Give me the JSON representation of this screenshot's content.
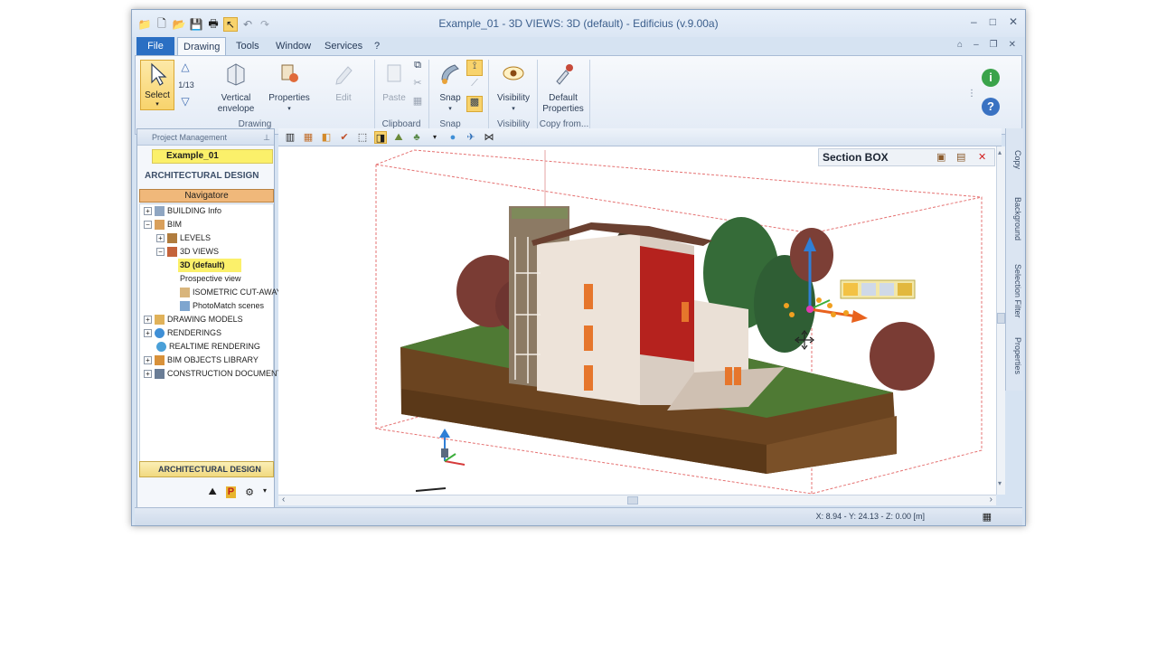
{
  "window": {
    "title": "Example_01  -  3D VIEWS: 3D (default) - Edificius (v.9.00a)",
    "controls": [
      "–",
      "□",
      "✕"
    ],
    "mdi_controls": [
      "⌂",
      "–",
      "❐",
      "✕"
    ]
  },
  "quick_access": [
    "📁",
    "🗋",
    "📂",
    "💾",
    "🖶",
    "↖",
    "↶",
    "↷"
  ],
  "tabs": {
    "file": "File",
    "items": [
      "Drawing",
      "Tools",
      "Window",
      "Services",
      "?"
    ],
    "active": "Drawing"
  },
  "ribbon": {
    "select": "Select",
    "counter": "1/13",
    "vertical_envelope": [
      "Vertical",
      "envelope"
    ],
    "properties": "Properties",
    "edit": "Edit",
    "paste": "Paste",
    "snap": "Snap",
    "visibility": "Visibility",
    "default_properties": [
      "Default",
      "Properties"
    ],
    "groups": [
      "Drawing",
      "Clipboard",
      "Snap",
      "Visibility",
      "Copy from..."
    ]
  },
  "left_panel": {
    "header": "Project Management",
    "project": "Example_01",
    "section_title": "ARCHITECTURAL DESIGN",
    "navigator": "Navigatore",
    "tree": [
      {
        "label": "BUILDING Info",
        "level": 0,
        "expander": "+"
      },
      {
        "label": "BIM",
        "level": 0,
        "expander": "−"
      },
      {
        "label": "LEVELS",
        "level": 1,
        "expander": "+"
      },
      {
        "label": "3D VIEWS",
        "level": 1,
        "expander": "−"
      },
      {
        "label": "3D (default)",
        "level": 2,
        "expander": "",
        "selected": true
      },
      {
        "label": "Prospective view",
        "level": 2,
        "expander": ""
      },
      {
        "label": "ISOMETRIC CUT-AWAY",
        "level": 2,
        "expander": ""
      },
      {
        "label": "PhotoMatch scenes",
        "level": 2,
        "expander": ""
      },
      {
        "label": "DRAWING MODELS",
        "level": 0,
        "expander": "+"
      },
      {
        "label": "RENDERINGS",
        "level": 0,
        "expander": "+"
      },
      {
        "label": "REALTIME RENDERING",
        "level": 0,
        "expander": ""
      },
      {
        "label": "BIM OBJECTS LIBRARY",
        "level": 0,
        "expander": "+"
      },
      {
        "label": "CONSTRUCTION DOCUMENTS",
        "level": 0,
        "expander": "+"
      }
    ],
    "bottom_tab": "ARCHITECTURAL DESIGN"
  },
  "viewport": {
    "section_box_title": "Section BOX"
  },
  "right_tabs": [
    "Copy",
    "Background",
    "Selection Filter",
    "Properties"
  ],
  "status": {
    "coords": "X: 8.94 - Y: 24.13 - Z: 0.00 [m]"
  }
}
